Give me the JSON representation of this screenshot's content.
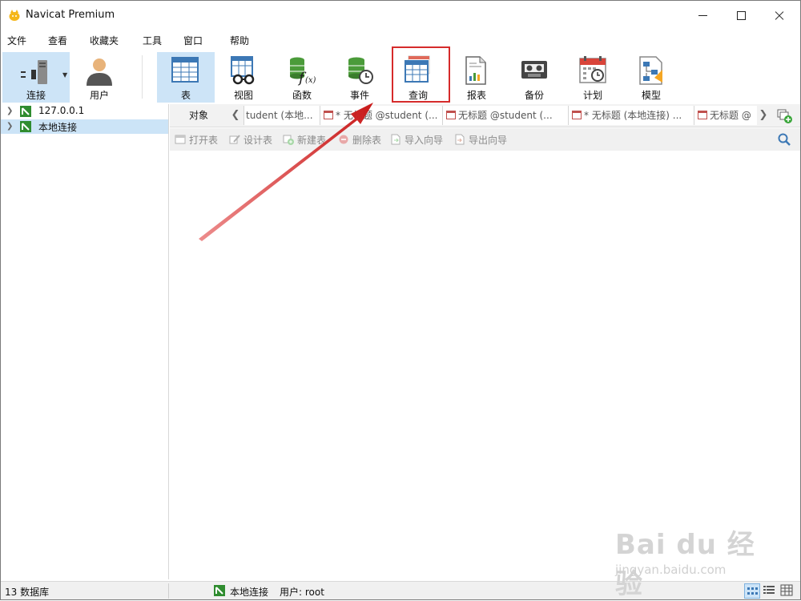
{
  "window": {
    "title": "Navicat Premium"
  },
  "menu": [
    "文件",
    "查看",
    "收藏夹",
    "工具",
    "窗口",
    "帮助"
  ],
  "toolbar": {
    "connect": "连接",
    "user": "用户",
    "table": "表",
    "view": "视图",
    "function": "函数",
    "event": "事件",
    "query": "查询",
    "report": "报表",
    "backup": "备份",
    "schedule": "计划",
    "model": "模型"
  },
  "tree": {
    "items": [
      {
        "label": "127.0.0.1"
      },
      {
        "label": "本地连接"
      }
    ]
  },
  "tabs": {
    "object": "对象",
    "items": [
      "tudent (本地...",
      "* 无标题 @student (...",
      "无标题 @student (...",
      "* 无标题 (本地连接) ...",
      "无标题 @"
    ]
  },
  "objbar": {
    "open": "打开表",
    "design": "设计表",
    "new": "新建表",
    "delete": "删除表",
    "import": "导入向导",
    "export": "导出向导"
  },
  "status": {
    "db_count": "13 数据库",
    "connection": "本地连接",
    "user": "用户: root"
  },
  "watermark": {
    "logo": "Bai du 经验",
    "url": "jingyan.baidu.com"
  },
  "colors": {
    "selection": "#cde4f7",
    "highlight_box": "#d62b2b",
    "arrow": "#d42020"
  }
}
